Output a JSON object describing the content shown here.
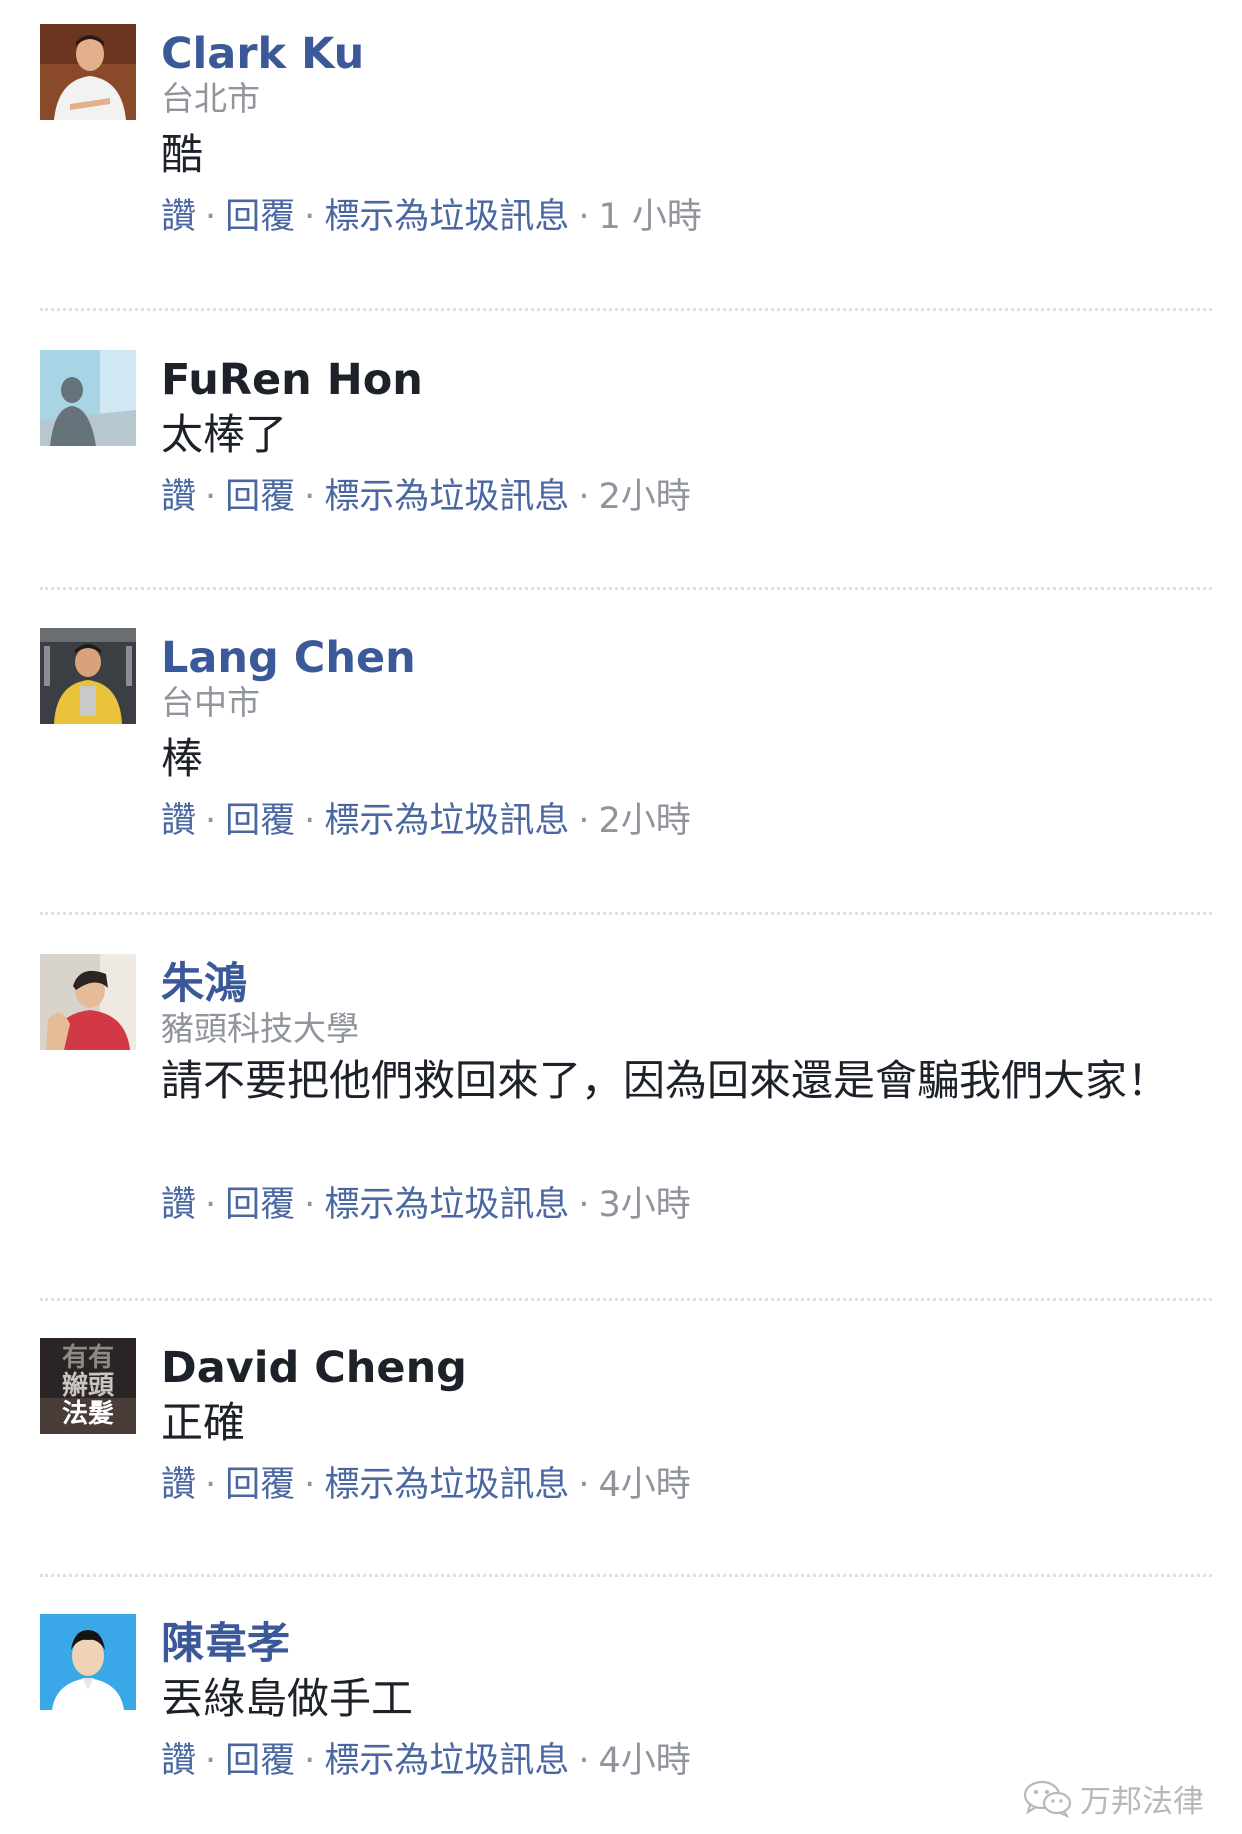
{
  "actions": {
    "like": "讚",
    "reply": "回覆",
    "mark_spam": "標示為垃圾訊息",
    "separator": "·"
  },
  "comments": [
    {
      "name": "Clark Ku",
      "location": "台北市",
      "text": "酷",
      "time": "1 小時",
      "avatar_icon": "man-in-white-shirt-avatar"
    },
    {
      "name": "FuRen Hon",
      "text": "太棒了",
      "time": "2小時",
      "avatar_icon": "silhouette-on-blue-avatar"
    },
    {
      "name": "Lang Chen",
      "location": "台中市",
      "text": "棒",
      "time": "2小時",
      "avatar_icon": "man-in-yellow-shirt-avatar"
    },
    {
      "name": "朱鴻",
      "location": "豬頭科技大學",
      "text": "請不要把他們救回來了，因為回來還是會騙我們大家！",
      "time": "3小時",
      "avatar_icon": "person-in-red-shirt-avatar"
    },
    {
      "name": "David Cheng",
      "text": "正確",
      "time": "4小時",
      "avatar_icon": "text-image-avatar",
      "avatar_text": [
        "有有",
        "辮頭",
        "法髮"
      ]
    },
    {
      "name": "陳韋孝",
      "text": "丟綠島做手工",
      "time": "4小時",
      "avatar_icon": "man-on-blue-background-avatar"
    }
  ],
  "watermark": {
    "text": "万邦法律",
    "icon": "wechat-icon"
  },
  "colors": {
    "link": "#3b5998",
    "action_link": "#4b67a1",
    "meta": "#90949c",
    "text": "#1d2129",
    "divider": "#dddfe2"
  }
}
